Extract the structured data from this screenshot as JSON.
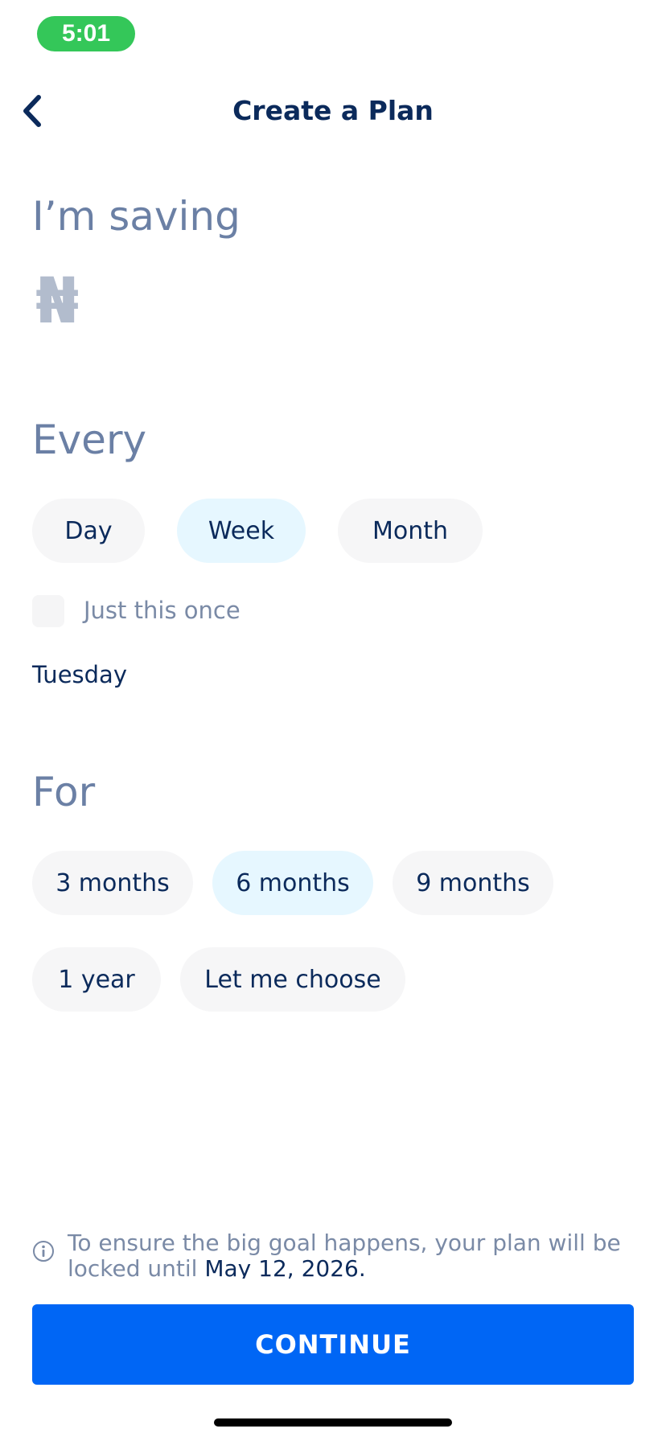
{
  "status_bar": {
    "time": "5:01"
  },
  "header": {
    "title": "Create a Plan",
    "back_icon": "chevron-left-icon"
  },
  "amount": {
    "label": "I’m saving",
    "currency_symbol": "₦"
  },
  "frequency": {
    "label": "Every",
    "options": [
      "Day",
      "Week",
      "Month"
    ],
    "selected": "Week",
    "once_label": "Just this once",
    "once_checked": false,
    "day": "Tuesday"
  },
  "duration": {
    "label": "For",
    "options": [
      "3 months",
      "6 months",
      "9 months",
      "1 year",
      "Let me choose"
    ],
    "selected": "6 months"
  },
  "notice": {
    "icon": "info-icon",
    "text": "To ensure the big goal happens, your plan will be locked until ",
    "date": "May 12, 2026."
  },
  "continue_label": "CONTINUE",
  "colors": {
    "accent": "#0066f5",
    "selected_pill": "#e6f7ff",
    "status_pill": "#34c759",
    "title": "#0b2a5b"
  }
}
